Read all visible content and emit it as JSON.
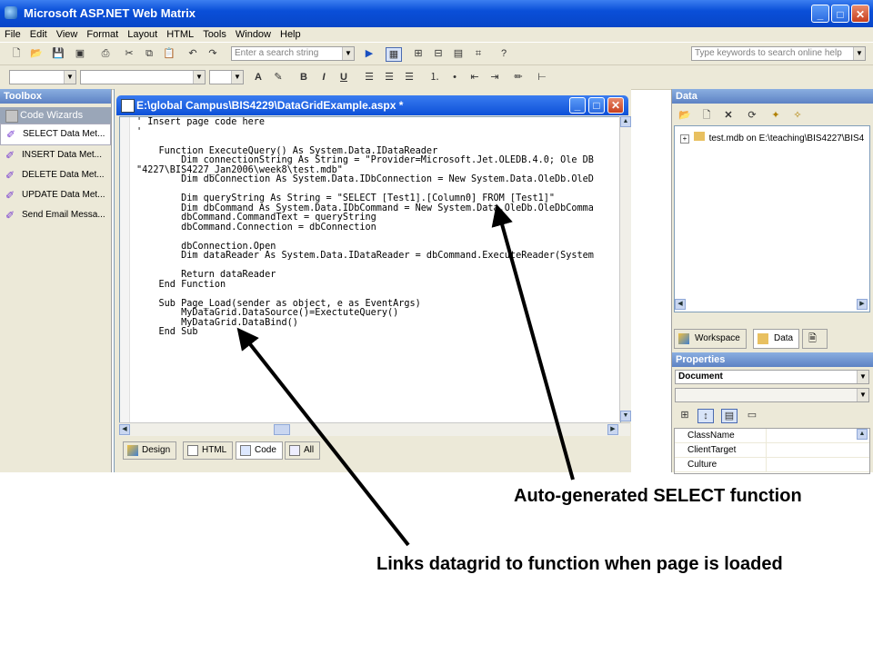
{
  "app": {
    "title": "Microsoft ASP.NET Web Matrix",
    "colors": {
      "titlebar": "#0a4fd8",
      "chrome": "#ece9d8",
      "panel_title": "#6b8fcf"
    }
  },
  "window_controls": {
    "minimize": "_",
    "maximize": "□",
    "close": "✕"
  },
  "menu": [
    "File",
    "Edit",
    "View",
    "Format",
    "Layout",
    "HTML",
    "Tools",
    "Window",
    "Help"
  ],
  "toolbar": {
    "search_placeholder": "Enter a search string",
    "online_help_placeholder": "Type keywords to search online help"
  },
  "format_toolbar": {
    "bold": "B",
    "italic": "I",
    "underline": "U"
  },
  "toolbox": {
    "title": "Toolbox",
    "group": "Code Wizards",
    "items": [
      {
        "label": "SELECT Data Met..."
      },
      {
        "label": "INSERT Data Met..."
      },
      {
        "label": "DELETE Data Met..."
      },
      {
        "label": "UPDATE Data Met..."
      },
      {
        "label": "Send Email Messa..."
      }
    ]
  },
  "editor": {
    "title": "E:\\global Campus\\BIS4229\\DataGridExample.aspx *",
    "code_lines": [
      "' Insert page code here",
      "'",
      "",
      "    Function ExecuteQuery() As System.Data.IDataReader",
      "        Dim connectionString As String = \"Provider=Microsoft.Jet.OLEDB.4.0; Ole DB",
      "\"4227\\BIS4227_Jan2006\\week8\\test.mdb\"",
      "        Dim dbConnection As System.Data.IDbConnection = New System.Data.OleDb.OleD",
      "",
      "        Dim queryString As String = \"SELECT [Test1].[Column0] FROM [Test1]\"",
      "        Dim dbCommand As System.Data.IDbCommand = New System.Data.OleDb.OleDbComma",
      "        dbCommand.CommandText = queryString",
      "        dbCommand.Connection = dbConnection",
      "",
      "        dbConnection.Open",
      "        Dim dataReader As System.Data.IDataReader = dbCommand.ExecuteReader(System",
      "",
      "        Return dataReader",
      "    End Function",
      "",
      "    Sub Page_Load(sender as object, e as EventArgs)",
      "        MyDataGrid.DataSource()=ExectuteQuery()",
      "        MyDataGrid.DataBind()",
      "    End Sub"
    ],
    "tabs": [
      {
        "label": "Design"
      },
      {
        "label": "HTML"
      },
      {
        "label": "Code"
      },
      {
        "label": "All"
      }
    ]
  },
  "data_panel": {
    "title": "Data",
    "tree_node": "test.mdb on E:\\teaching\\BIS4227\\BIS4",
    "tabs": [
      {
        "label": "Workspace"
      },
      {
        "label": "Data"
      }
    ]
  },
  "properties": {
    "title": "Properties",
    "selected": "Document",
    "rows": [
      {
        "name": "ClassName"
      },
      {
        "name": "ClientTarget"
      },
      {
        "name": "Culture"
      }
    ]
  },
  "annotations": {
    "select_function": "Auto-generated SELECT function",
    "page_load": "Links datagrid to function when page is loaded"
  }
}
